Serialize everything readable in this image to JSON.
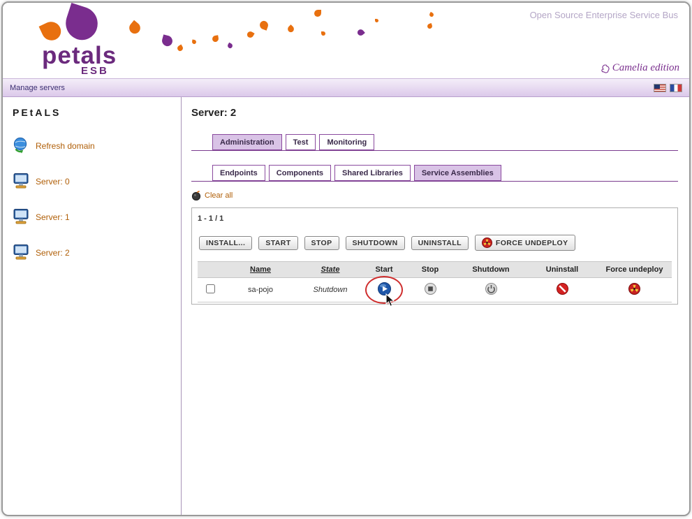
{
  "header": {
    "tagline": "Open Source Enterprise Service Bus",
    "logo_text": "petals",
    "logo_sub": "ESB",
    "edition_label": "Camelia edition"
  },
  "menubar": {
    "manage_servers_label": "Manage servers",
    "language_flags": [
      "us-flag-icon",
      "fr-flag-icon"
    ]
  },
  "sidebar": {
    "brand": "PEtALS",
    "items": [
      {
        "label": "Refresh domain",
        "icon": "globe-refresh-icon"
      },
      {
        "label": "Server: 0",
        "icon": "server-icon"
      },
      {
        "label": "Server: 1",
        "icon": "server-icon"
      },
      {
        "label": "Server: 2",
        "icon": "server-icon"
      }
    ]
  },
  "main": {
    "title": "Server: 2",
    "primary_tabs": [
      {
        "label": "Administration",
        "active": true
      },
      {
        "label": "Test",
        "active": false
      },
      {
        "label": "Monitoring",
        "active": false
      }
    ],
    "secondary_tabs": [
      {
        "label": "Endpoints",
        "active": false
      },
      {
        "label": "Components",
        "active": false
      },
      {
        "label": "Shared Libraries",
        "active": false
      },
      {
        "label": "Service Assemblies",
        "active": true
      }
    ],
    "clear_all_label": "Clear all",
    "panel": {
      "pagination": "1 - 1 / 1",
      "actions": [
        {
          "label": "INSTALL..."
        },
        {
          "label": "START"
        },
        {
          "label": "STOP"
        },
        {
          "label": "SHUTDOWN"
        },
        {
          "label": "UNINSTALL"
        },
        {
          "label": "FORCE UNDEPLOY",
          "icon": "force-undeploy-icon"
        }
      ],
      "table": {
        "headers": [
          "Name",
          "State",
          "Start",
          "Stop",
          "Shutdown",
          "Uninstall",
          "Force undeploy"
        ],
        "rows": [
          {
            "name": "sa-pojo",
            "state": "Shutdown",
            "row_icons": [
              "start-icon",
              "stop-icon",
              "shutdown-icon",
              "uninstall-icon",
              "force-undeploy-icon"
            ]
          }
        ]
      }
    }
  },
  "annotations": {
    "highlight": "red-ellipse-around-start-action",
    "cursor": "mouse-pointer"
  },
  "colors": {
    "brand_purple": "#6b2a7d",
    "tab_border_purple": "#8a4a9e",
    "menubar_lavender": "#dcc9ea",
    "link_orange": "#b05f08",
    "action_red": "#c92121",
    "action_blue": "#1e56a8"
  }
}
